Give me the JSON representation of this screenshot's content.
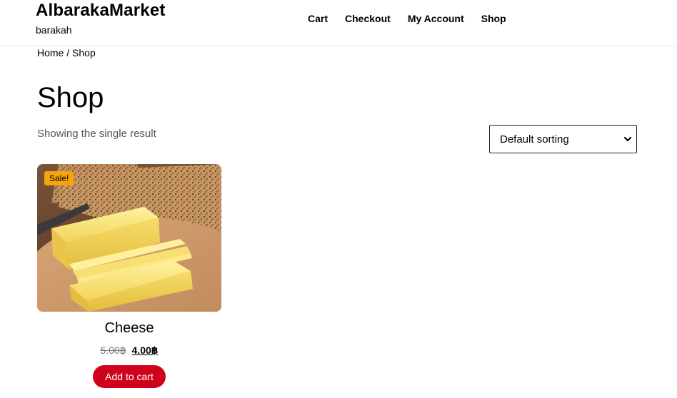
{
  "site": {
    "title": "AlbarakaMarket",
    "tagline": "barakah"
  },
  "nav": {
    "items": [
      {
        "label": "Cart"
      },
      {
        "label": "Checkout"
      },
      {
        "label": "My Account"
      },
      {
        "label": "Shop"
      }
    ]
  },
  "breadcrumb": {
    "home": "Home",
    "separator": " / ",
    "current": "Shop"
  },
  "page": {
    "title": "Shop",
    "result_count": "Showing the single result"
  },
  "sorting": {
    "selected": "Default sorting"
  },
  "products": [
    {
      "name": "Cheese",
      "badge": "Sale!",
      "old_price": "5.00฿",
      "new_price": "4.00฿",
      "button_label": "Add to cart",
      "image_icon": "cheese-image"
    }
  ],
  "colors": {
    "sale_badge": "#f5a40c",
    "button": "#d0021b",
    "text": "#000000",
    "muted": "#555555"
  }
}
